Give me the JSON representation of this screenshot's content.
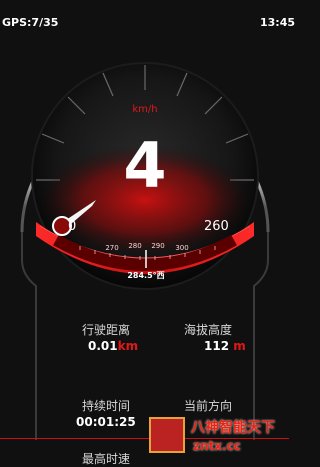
{
  "status_bar": {
    "gps": "GPS:7/35",
    "time": "13:45"
  },
  "speedometer": {
    "unit": "km/h",
    "speed": "4",
    "min": "0",
    "max": "260",
    "compass_ticks": [
      "270",
      "280",
      "290",
      "300"
    ],
    "compass_heading": "284.5°西"
  },
  "metrics": {
    "distance": {
      "label": "行驶距离",
      "value": "0.01",
      "unit": "km"
    },
    "altitude": {
      "label": "海拔高度",
      "value": "112",
      "unit": "m"
    },
    "duration": {
      "label": "持续时间",
      "value": "00:01:25"
    },
    "direction": {
      "label": "当前方向"
    },
    "top_speed": {
      "label": "最高时速"
    }
  },
  "watermark": {
    "title": "八神智能天下",
    "url": "zntx.cc"
  },
  "colors": {
    "accent": "#e01818",
    "background": "#101010"
  }
}
